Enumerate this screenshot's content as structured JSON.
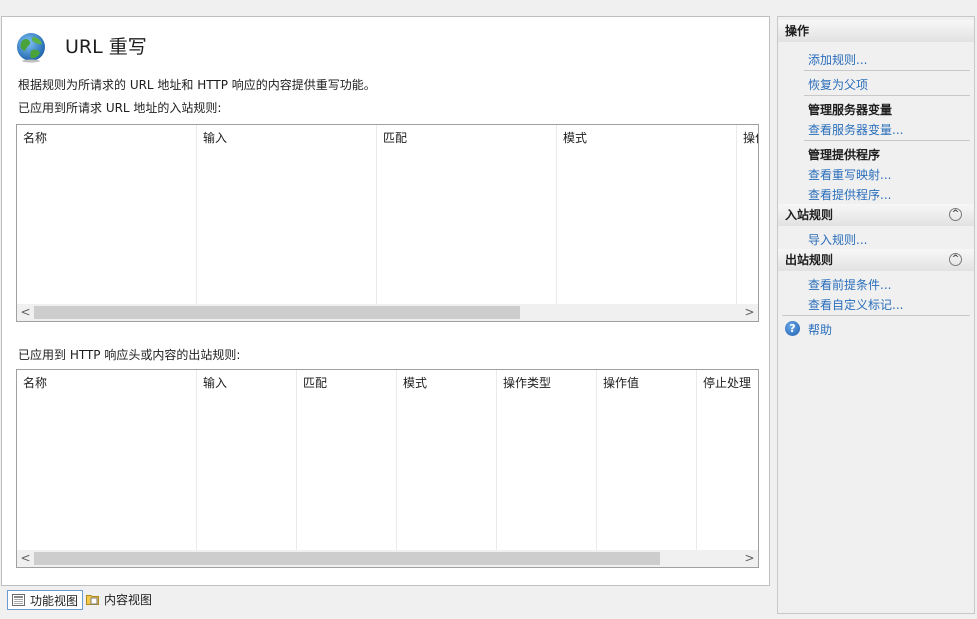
{
  "main": {
    "title": "URL 重写",
    "description": "根据规则为所请求的 URL 地址和 HTTP 响应的内容提供重写功能。",
    "inbound": {
      "label": "已应用到所请求 URL 地址的入站规则:",
      "columns": [
        "名称",
        "输入",
        "匹配",
        "模式",
        "操作"
      ]
    },
    "outbound": {
      "label": "已应用到 HTTP 响应头或内容的出站规则:",
      "columns": [
        "名称",
        "输入",
        "匹配",
        "模式",
        "操作类型",
        "操作值",
        "停止处理"
      ]
    },
    "scroll_left": "<",
    "scroll_right": ">"
  },
  "actions": {
    "header": "操作",
    "add_rule": "添加规则...",
    "revert_parent": "恢复为父项",
    "server_vars_title": "管理服务器变量",
    "view_server_vars": "查看服务器变量...",
    "providers_title": "管理提供程序",
    "view_rewrite_maps": "查看重写映射...",
    "view_providers": "查看提供程序...",
    "inbound_header": "入站规则",
    "import_rules": "导入规则...",
    "outbound_header": "出站规则",
    "view_preconditions": "查看前提条件...",
    "view_custom_tags": "查看自定义标记...",
    "help": "帮助",
    "collapse_glyph": "^",
    "help_glyph": "?"
  },
  "bottom": {
    "features_view": "功能视图",
    "content_view": "内容视图"
  },
  "colors": {
    "link": "#2a6ebb",
    "header_bg": "#e2e2e2",
    "active_tab_border": "#6b9bd1"
  }
}
